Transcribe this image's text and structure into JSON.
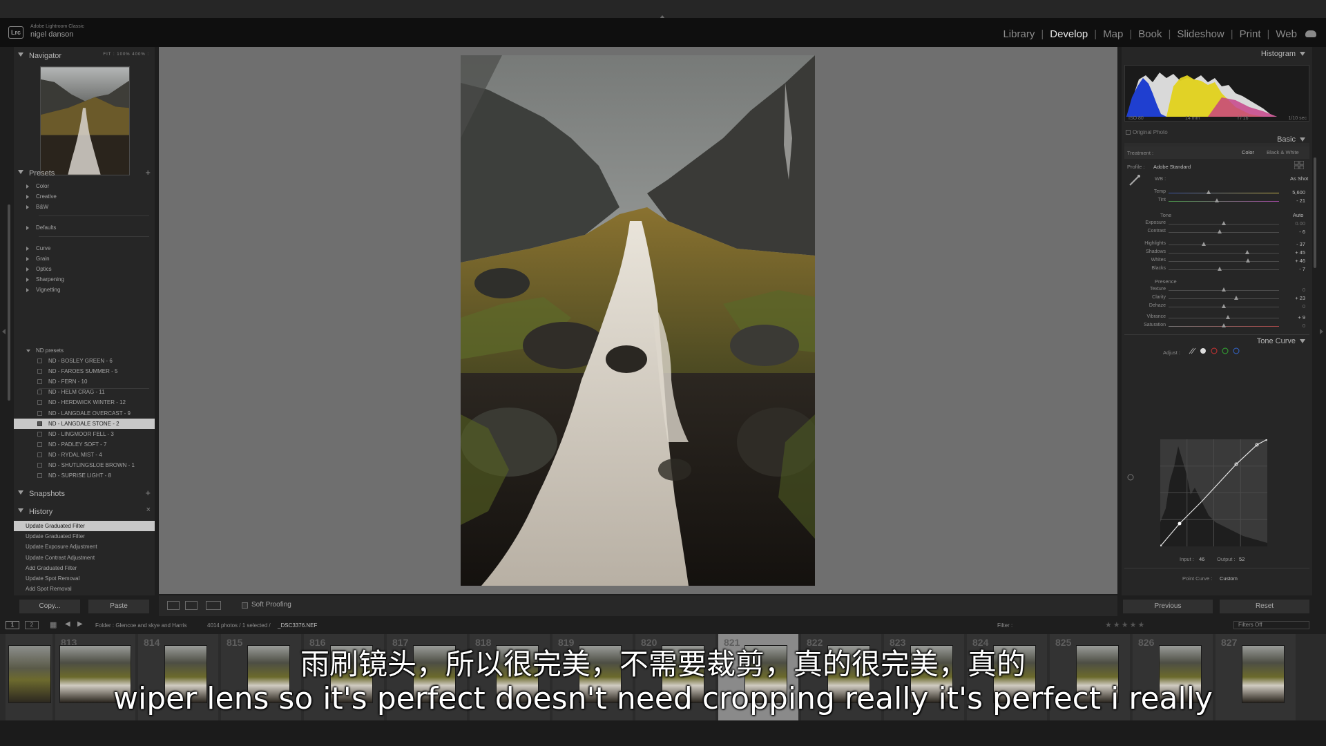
{
  "app": {
    "logo": "Lrc",
    "name": "Adobe Lightroom Classic",
    "user": "nigel danson"
  },
  "modules": [
    "Library",
    "Develop",
    "Map",
    "Book",
    "Slideshow",
    "Print",
    "Web"
  ],
  "active_module": "Develop",
  "left_panel": {
    "navigator": {
      "label": "Navigator",
      "zoom_options": "FIT : 100% 400% :"
    },
    "presets": {
      "label": "Presets",
      "groups_a": [
        "Color",
        "Creative",
        "B&W"
      ],
      "groups_b": [
        "Defaults"
      ],
      "groups_c": [
        "Curve",
        "Grain",
        "Optics",
        "Sharpening",
        "Vignetting"
      ],
      "open_group": "ND presets",
      "items": [
        "ND - BOSLEY GREEN - 6",
        "ND - FAROES SUMMER - 5",
        "ND - FERN - 10",
        "ND - HELM CRAG - 11",
        "ND - HERDWICK WINTER - 12",
        "ND - LANGDALE OVERCAST - 9",
        "ND - LANGDALE STONE - 2",
        "ND - LINGMOOR FELL - 3",
        "ND - PADLEY SOFT - 7",
        "ND - RYDAL MIST - 4",
        "ND - SHUTLINGSLOE BROWN - 1",
        "ND - SUPRISE LIGHT - 8"
      ],
      "selected_index": 6
    },
    "snapshots": {
      "label": "Snapshots"
    },
    "history": {
      "label": "History",
      "items": [
        "Update Graduated Filter",
        "Update Graduated Filter",
        "Update Exposure Adjustment",
        "Update Contrast Adjustment",
        "Add Graduated Filter",
        "Update Spot Removal",
        "Add Spot Removal"
      ]
    },
    "copy_label": "Copy...",
    "paste_label": "Paste"
  },
  "toolbar": {
    "soft_proofing": "Soft Proofing"
  },
  "right_panel": {
    "histogram": {
      "label": "Histogram",
      "iso": "ISO 80",
      "focal": "14 mm",
      "aperture": "f / 16",
      "shutter": "1/10 sec",
      "original_photo": "Original Photo"
    },
    "basic": {
      "label": "Basic",
      "treatment_label": "Treatment :",
      "treatment_color": "Color",
      "treatment_bw": "Black & White",
      "profile_label": "Profile :",
      "profile_value": "Adobe Standard",
      "wb_label": "WB :",
      "wb_value": "As Shot",
      "tone_label": "Tone",
      "auto_label": "Auto",
      "presence_label": "Presence",
      "sliders": [
        {
          "label": "Temp",
          "value": "5,600"
        },
        {
          "label": "Tint",
          "value": "- 21"
        },
        {
          "label": "Exposure",
          "value": "0.00"
        },
        {
          "label": "Contrast",
          "value": "- 6"
        },
        {
          "label": "Highlights",
          "value": "- 37"
        },
        {
          "label": "Shadows",
          "value": "+ 45"
        },
        {
          "label": "Whites",
          "value": "+ 46"
        },
        {
          "label": "Blacks",
          "value": "- 7"
        },
        {
          "label": "Texture",
          "value": "0"
        },
        {
          "label": "Clarity",
          "value": "+ 23"
        },
        {
          "label": "Dehaze",
          "value": "0"
        },
        {
          "label": "Vibrance",
          "value": "+ 9"
        },
        {
          "label": "Saturation",
          "value": "0"
        }
      ]
    },
    "tone_curve": {
      "label": "Tone Curve",
      "adjust_label": "Adjust :",
      "input_label": "Input :",
      "input_value": "46",
      "output_label": "Output :",
      "output_value": "52",
      "point_curve_label": "Point Curve :",
      "point_curve_value": "Custom"
    },
    "previous_label": "Previous",
    "reset_label": "Reset"
  },
  "filmstrip_bar": {
    "page1": "1",
    "page2": "2",
    "folder": "Folder : Glencoe and skye and Harris",
    "count": "4014 photos / 1 selected /",
    "filename": "_DSC3376.NEF",
    "filter_label": "Filter :",
    "filters_off": "Filters Off"
  },
  "filmstrip": {
    "numbers": [
      "813",
      "814",
      "815",
      "816",
      "817",
      "818",
      "819",
      "820",
      "821",
      "822",
      "823",
      "824",
      "825",
      "826",
      "827"
    ]
  },
  "subtitles": {
    "zh": "雨刷镜头，所以很完美，不需要裁剪，真的很完美，真的",
    "en": "wiper lens so it's perfect doesn't need cropping really it's perfect i really"
  },
  "colors": {
    "accent_selected": "#c8c8c8",
    "canvas": "#6f6f6f",
    "panel": "#262626"
  }
}
